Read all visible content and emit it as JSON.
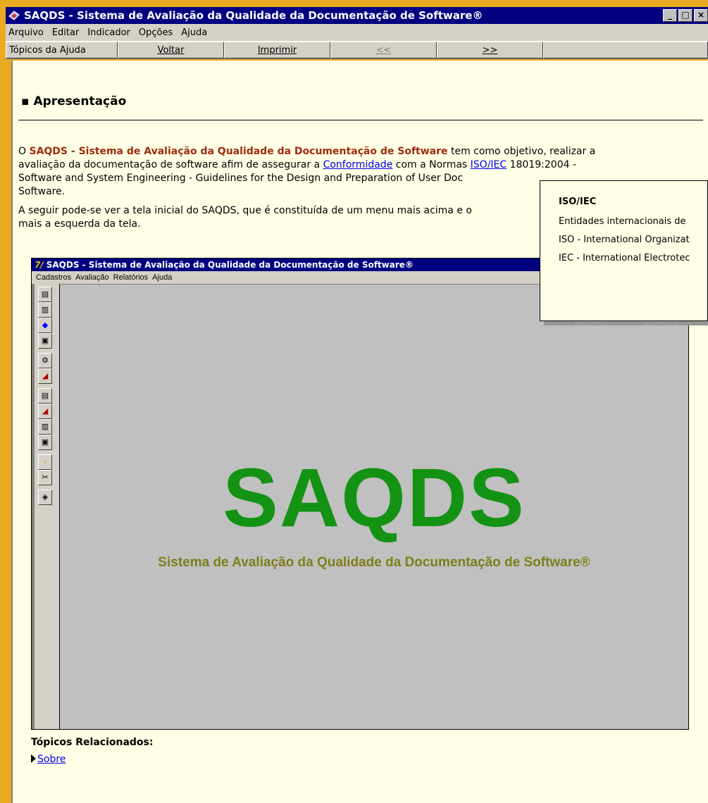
{
  "window": {
    "title": "SAQDS - Sistema de Avaliação da Qualidade da Documentação de Software®",
    "controls": [
      "_",
      "□",
      "×"
    ]
  },
  "menu": {
    "items": [
      "Arquivo",
      "Editar",
      "Indicador",
      "Opções",
      "Ajuda"
    ]
  },
  "toolbar": {
    "topics": "Tópicos da Ajuda",
    "back": "Voltar",
    "print": "Imprimir",
    "prev": "<<",
    "next": ">>"
  },
  "page": {
    "heading": "Apresentação",
    "p1_prefix": "O ",
    "p1_brand": "SAQDS - Sistema de Avaliação da Qualidade da Documentação de Software",
    "p1_mid": " tem como objetivo, realizar a",
    "p1_line2_a": "avaliação da documentação de software afim de assegurar a ",
    "p1_link1": "Conformidade",
    "p1_line2_b": " com a Normas ",
    "p1_link2": "ISO/IEC",
    "p1_line2_c": " 18019:2004 -",
    "p1_line3": "Software and System Engineering - Guidelines for the Design and Preparation of User Doc",
    "p1_line4": "Software.",
    "p2_line1": "A seguir pode-se ver a tela inicial do SAQDS, que é constituída de um menu mais acima e o",
    "p2_line2": "mais a esquerda da tela."
  },
  "inner": {
    "title": "SAQDS - Sistema de Avaliação da Qualidade da Documentação de Software®",
    "menu": [
      "Cadastros",
      "Avaliação",
      "Relatórios",
      "Ajuda"
    ],
    "logo": "SAQDS",
    "subtitle": "Sistema de Avaliação da Qualidade da Documentação de Software®"
  },
  "related": {
    "label": "Tópicos Relacionados:",
    "link": "Sobre"
  },
  "popup": {
    "title": "ISO/IEC",
    "line1": "Entidades internacionais de",
    "line2": "ISO - International Organizat",
    "line3": "IEC - International Electrotec"
  }
}
